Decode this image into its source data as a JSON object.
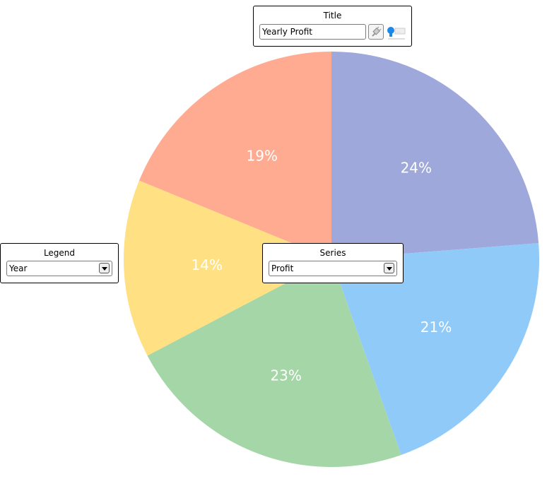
{
  "chart_data": {
    "type": "pie",
    "title": "Yearly Profit",
    "values": [
      24,
      21,
      23,
      14,
      19
    ],
    "labels": [
      "24%",
      "21%",
      "23%",
      "14%",
      "19%"
    ],
    "colors": [
      "#9fa8da",
      "#90caf9",
      "#a5d6a7",
      "#ffe082",
      "#ffab91"
    ],
    "start_angle": "top",
    "direction": "clockwise"
  },
  "title_panel": {
    "caption": "Title",
    "value": "Yearly Profit",
    "icons": [
      "plug-icon",
      "speech-icon"
    ]
  },
  "legend_panel": {
    "caption": "Legend",
    "value": "Year"
  },
  "series_panel": {
    "caption": "Series",
    "value": "Profit"
  }
}
